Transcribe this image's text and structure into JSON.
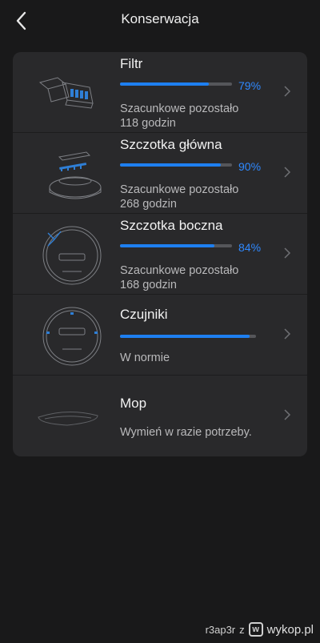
{
  "header": {
    "title": "Konserwacja"
  },
  "items": [
    {
      "name": "Filtr",
      "percent_label": "79%",
      "percent": 79,
      "line1": "Szacunkowe pozostało",
      "line2": "118 godzin",
      "icon": "filter-icon"
    },
    {
      "name": "Szczotka główna",
      "percent_label": "90%",
      "percent": 90,
      "line1": "Szacunkowe pozostało",
      "line2": "268 godzin",
      "icon": "main-brush-icon"
    },
    {
      "name": "Szczotka boczna",
      "percent_label": "84%",
      "percent": 84,
      "line1": "Szacunkowe pozostało",
      "line2": "168 godzin",
      "icon": "side-brush-icon"
    },
    {
      "name": "Czujniki",
      "percent": 95,
      "line1": "W normie",
      "icon": "sensors-icon"
    },
    {
      "name": "Mop",
      "line1": "Wymień w razie potrzeby.",
      "icon": "mop-icon"
    }
  ],
  "watermark": {
    "user": "r3ap3r",
    "sep": "z",
    "brand": "wykop.pl"
  },
  "colors": {
    "accent": "#1e7ff0",
    "background": "#19191a",
    "card": "#29292b"
  }
}
